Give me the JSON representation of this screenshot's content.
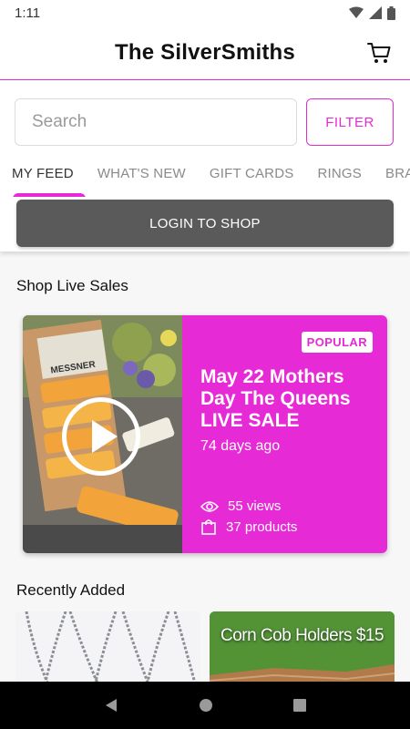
{
  "status_bar": {
    "time": "1:11",
    "icons": [
      "wifi-icon",
      "signal-icon",
      "battery-icon"
    ]
  },
  "header": {
    "title": "The SilverSmiths",
    "cart_icon": "cart-icon"
  },
  "search": {
    "placeholder": "Search",
    "value": "",
    "filter_label": "FILTER"
  },
  "tabs": [
    "MY FEED",
    "WHAT'S NEW",
    "GIFT CARDS",
    "RINGS",
    "BRA"
  ],
  "login": {
    "label": "LOGIN TO SHOP"
  },
  "live_sales": {
    "section_title": "Shop Live Sales",
    "card": {
      "badge": "POPULAR",
      "title": "May 22 Mothers Day The Queens LIVE SALE",
      "ago": "74 days ago",
      "views": "55 views",
      "products": "37 products",
      "thumb_brand": "MESSNER"
    }
  },
  "recent": {
    "section_title": "Recently Added",
    "items": [
      {
        "caption": ""
      },
      {
        "caption": "Corn Cob Holders $15"
      }
    ]
  },
  "nav_bar": {
    "buttons": [
      "back-icon",
      "home-icon",
      "recents-icon"
    ]
  },
  "colors": {
    "accent": "#e62ad6",
    "login_button": "#5a5a5a"
  }
}
